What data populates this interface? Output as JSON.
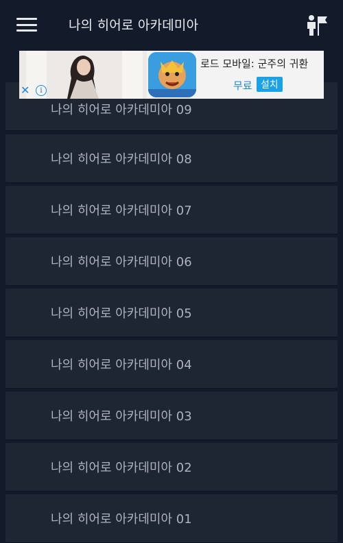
{
  "appbar": {
    "title": "나의 히어로 아카데미아",
    "menu_icon": "hamburger-menu-icon",
    "action_icon": "person-flag-icon"
  },
  "ad": {
    "title": "로드 모바일: 군주의 귀환",
    "free_label": "무료",
    "install_label": "설치",
    "close_icon": "close-icon",
    "info_icon": "info-icon"
  },
  "episodes": [
    {
      "label": "나의 히어로 아카데미아 09"
    },
    {
      "label": "나의 히어로 아카데미아 08"
    },
    {
      "label": "나의 히어로 아카데미아 07"
    },
    {
      "label": "나의 히어로 아카데미아 06"
    },
    {
      "label": "나의 히어로 아카데미아 05"
    },
    {
      "label": "나의 히어로 아카데미아 04"
    },
    {
      "label": "나의 히어로 아카데미아 03"
    },
    {
      "label": "나의 히어로 아카데미아 02"
    },
    {
      "label": "나의 히어로 아카데미아 01"
    }
  ],
  "colors": {
    "background": "#131a2a",
    "list_item": "#1e2533",
    "item_text": "#aeb3bd",
    "ad_accent": "#1ba1e6"
  }
}
